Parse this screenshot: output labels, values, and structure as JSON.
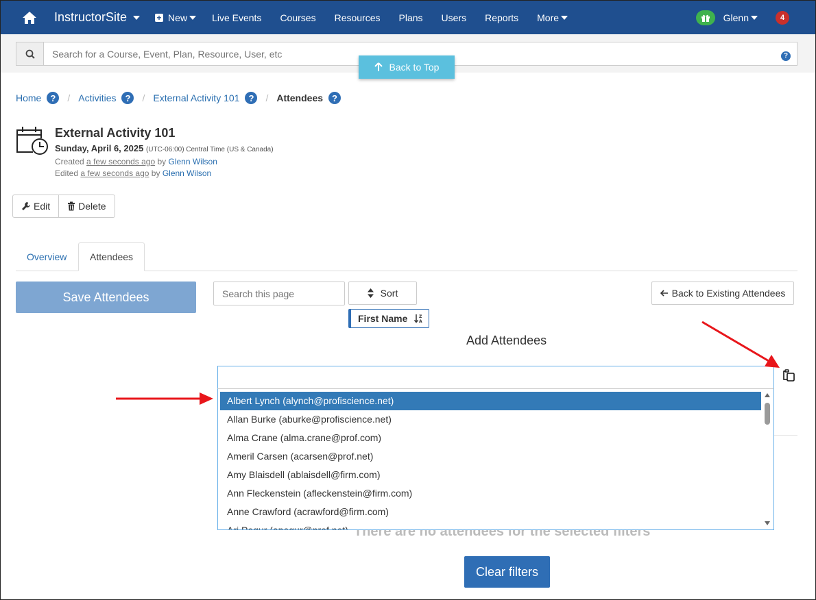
{
  "navbar": {
    "brand": "InstructorSite",
    "items": [
      {
        "label": "New"
      },
      {
        "label": "Live Events"
      },
      {
        "label": "Courses"
      },
      {
        "label": "Resources"
      },
      {
        "label": "Plans"
      },
      {
        "label": "Users"
      },
      {
        "label": "Reports"
      },
      {
        "label": "More"
      }
    ],
    "user": "Glenn",
    "notification_count": "4"
  },
  "search": {
    "placeholder": "Search for a Course, Event, Plan, Resource, User, etc"
  },
  "back_to_top": "Back to Top",
  "breadcrumb": {
    "home": "Home",
    "activities": "Activities",
    "activity": "External Activity 101",
    "current": "Attendees",
    "help": "?"
  },
  "event": {
    "title": "External Activity 101",
    "date": "Sunday, April 6, 2025",
    "timezone": "(UTC-06:00) Central Time (US & Canada)",
    "created_prefix": "Created",
    "created_when": "a few seconds ago",
    "created_by_word": "by",
    "created_by": "Glenn Wilson",
    "edited_prefix": "Edited",
    "edited_when": "a few seconds ago",
    "edited_by_word": "by",
    "edited_by": "Glenn Wilson"
  },
  "actions": {
    "edit": "Edit",
    "delete": "Delete"
  },
  "tabs": {
    "overview": "Overview",
    "attendees": "Attendees"
  },
  "toolbar": {
    "save": "Save Attendees",
    "page_search_placeholder": "Search this page",
    "sort": "Sort",
    "sort_field": "First Name",
    "back_existing": "Back to Existing Attendees"
  },
  "add_attendees_heading": "Add Attendees",
  "dropdown_options": [
    "Albert Lynch (alynch@profiscience.net)",
    "Allan Burke (aburke@profiscience.net)",
    "Alma Crane (alma.crane@prof.com)",
    "Ameril Carsen (acarsen@prof.net)",
    "Amy Blaisdell (ablaisdell@firm.com)",
    "Ann Fleckenstein (afleckenstein@firm.com)",
    "Anne Crawford (acrawford@firm.com)",
    "Ari Pegur (apegur@prof.net)"
  ],
  "empty_state": "There are no attendees for the selected filters",
  "clear_filters": "Clear filters",
  "colors": {
    "navbar": "#1f4f8f",
    "selected_option": "#337ab7",
    "save_button": "#7ea6d2",
    "back_to_top": "#5bc0de",
    "annotation_arrow": "#e8161b"
  }
}
